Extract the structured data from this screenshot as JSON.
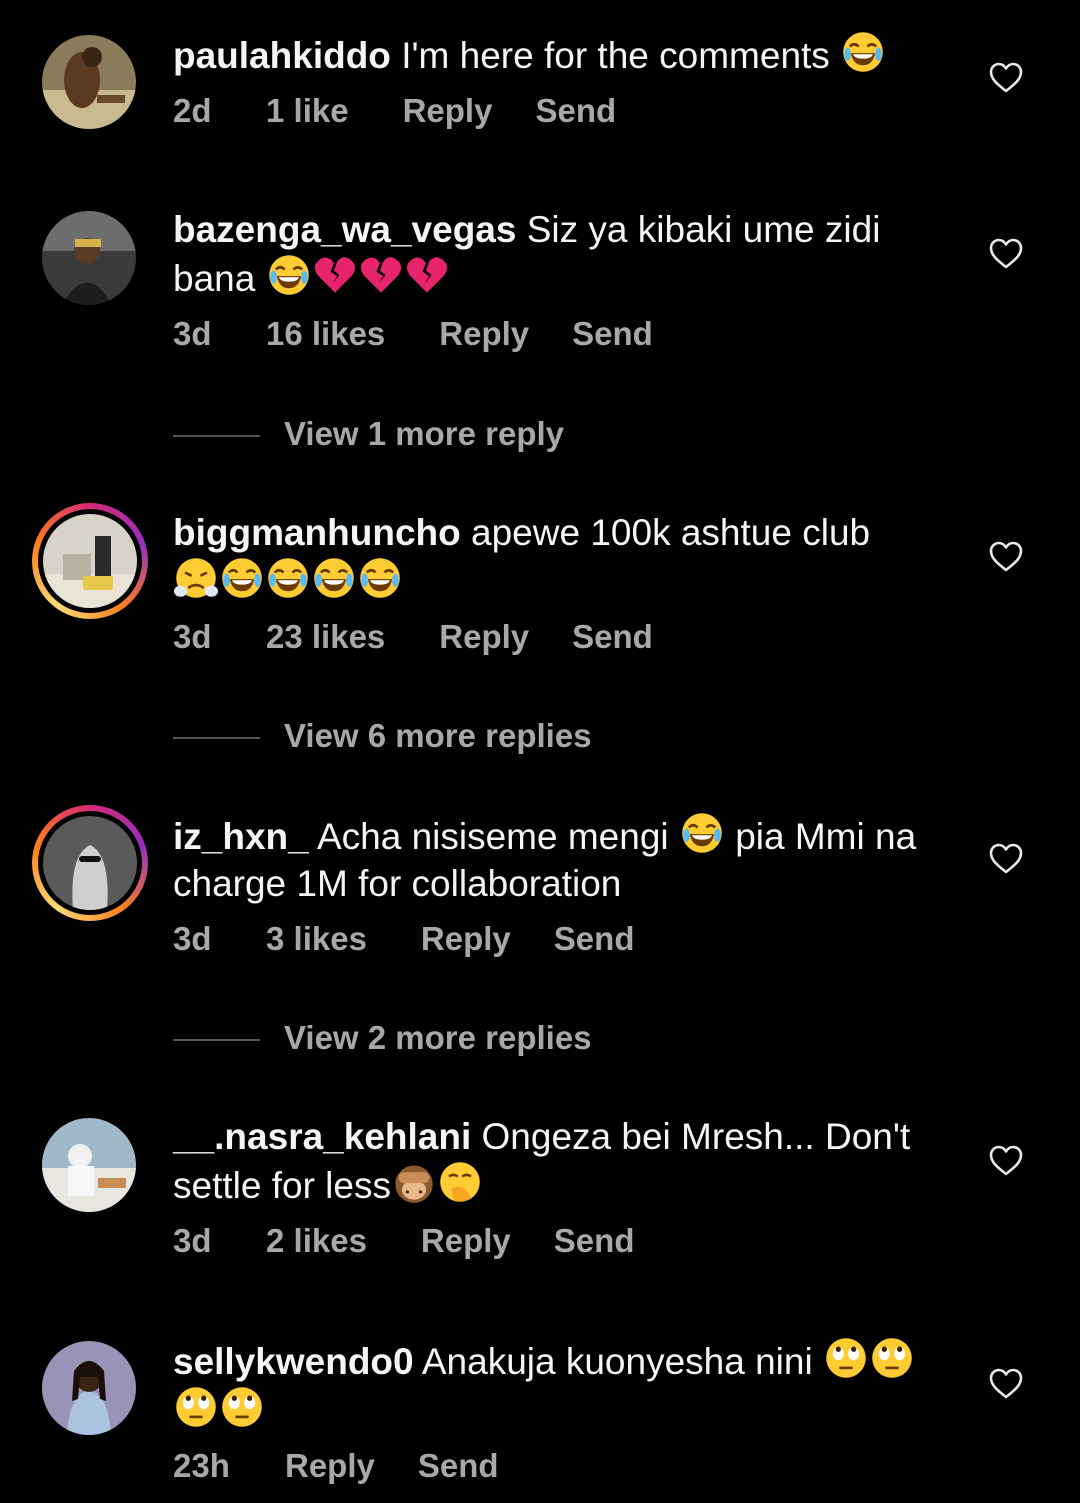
{
  "colors": {
    "background": "#000000",
    "text": "#f5f5f5",
    "meta": "#a8a8a8",
    "story_ring": [
      "#d62976",
      "#962fbf",
      "#fa7e1e",
      "#feda75"
    ]
  },
  "comments": [
    {
      "username": "paulahkiddo",
      "text": "I'm here for the comments",
      "emojis": [
        "joy"
      ],
      "time": "2d",
      "likes": "1 like",
      "reply_label": "Reply",
      "send_label": "Send",
      "has_story": false
    },
    {
      "username": "bazenga_wa_vegas",
      "text": "Siz ya kibaki ume zidi bana",
      "emojis": [
        "joy",
        "broken-heart",
        "broken-heart",
        "broken-heart"
      ],
      "time": "3d",
      "likes": "16 likes",
      "reply_label": "Reply",
      "send_label": "Send",
      "has_story": false,
      "view_replies": "View 1 more reply"
    },
    {
      "username": "biggmanhuncho",
      "text": "apewe 100k ashtue club",
      "emojis": [
        "steam",
        "joy",
        "joy",
        "joy",
        "joy"
      ],
      "time": "3d",
      "likes": "23 likes",
      "reply_label": "Reply",
      "send_label": "Send",
      "has_story": true,
      "view_replies": "View 6 more replies"
    },
    {
      "username": "iz_hxn_",
      "text_before": "Acha nisiseme mengi",
      "text_after": "pia Mmi na charge 1M for collaboration",
      "emojis": [
        "joy"
      ],
      "time": "3d",
      "likes": "3 likes",
      "reply_label": "Reply",
      "send_label": "Send",
      "has_story": true,
      "view_replies": "View 2 more replies"
    },
    {
      "username": "__.nasra_kehlani",
      "text": "Ongeza bei Mresh... Don't settle for less",
      "emojis": [
        "see-no-evil",
        "hand-over-mouth"
      ],
      "time": "3d",
      "likes": "2 likes",
      "reply_label": "Reply",
      "send_label": "Send",
      "has_story": false
    },
    {
      "username": "sellykwendo0",
      "text": "Anakuja kuonyesha nini",
      "emojis": [
        "eye-roll",
        "eye-roll",
        "eye-roll",
        "eye-roll"
      ],
      "time": "23h",
      "reply_label": "Reply",
      "send_label": "Send",
      "has_story": false
    }
  ]
}
